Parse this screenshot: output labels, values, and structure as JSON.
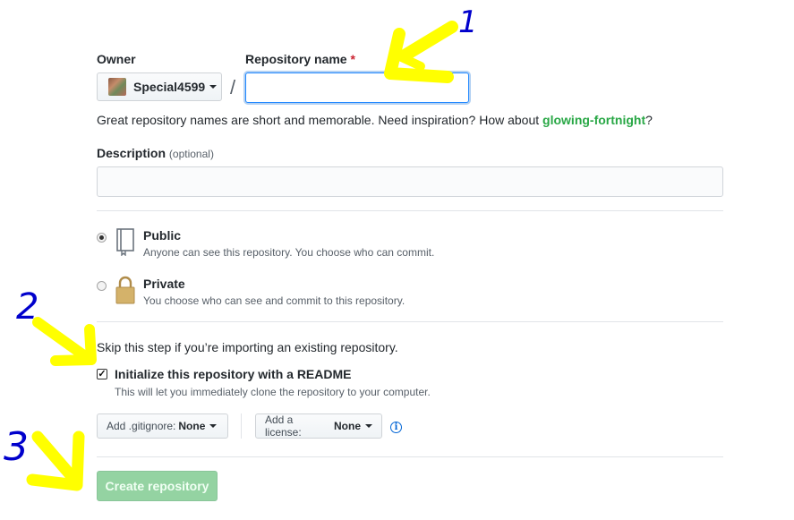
{
  "owner": {
    "label": "Owner",
    "value": "Special4599"
  },
  "repo_name": {
    "label": "Repository name",
    "required_mark": "*",
    "slash": "/",
    "value": ""
  },
  "hint": {
    "text": "Great repository names are short and memorable. Need inspiration? How about ",
    "suggestion": "glowing-fortnight",
    "end": "?"
  },
  "description": {
    "label": "Description",
    "optional": "(optional)",
    "value": ""
  },
  "visibility": {
    "public": {
      "title": "Public",
      "desc": "Anyone can see this repository. You choose who can commit.",
      "selected": true
    },
    "private": {
      "title": "Private",
      "desc": "You choose who can see and commit to this repository.",
      "selected": false
    }
  },
  "init": {
    "skip_text": "Skip this step if you’re importing an existing repository.",
    "readme_label": "Initialize this repository with a README",
    "readme_desc": "This will let you immediately clone the repository to your computer.",
    "readme_checked": true
  },
  "gitignore": {
    "label": "Add .gitignore:",
    "value": "None"
  },
  "license": {
    "label": "Add a license:",
    "value": "None"
  },
  "info_glyph": "i",
  "create_button": "Create repository",
  "annotations": {
    "n1": "1",
    "n2": "2",
    "n3": "3",
    "arrow_color": "#ffff00",
    "number_color": "#0000cc"
  }
}
